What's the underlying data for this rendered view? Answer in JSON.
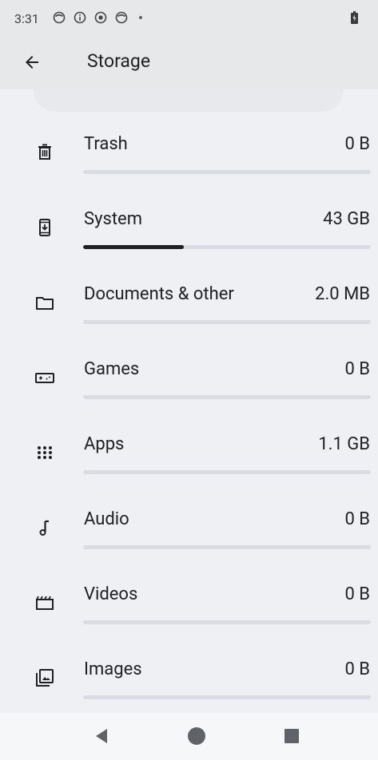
{
  "status_bar": {
    "time": "3:31",
    "icons": [
      "app-icon",
      "info-icon",
      "record-icon",
      "app-icon",
      "dot-icon"
    ],
    "battery_icon": "battery-charging-icon"
  },
  "app_bar": {
    "title": "Storage",
    "back_icon": "arrow-back-icon"
  },
  "storage_items": [
    {
      "label": "Trash",
      "value": "0 B",
      "icon": "trash-icon",
      "fill_fraction": 0
    },
    {
      "label": "System",
      "value": "43 GB",
      "icon": "system-update-icon",
      "fill_fraction": 0.35
    },
    {
      "label": "Documents & other",
      "value": "2.0 MB",
      "icon": "folder-icon",
      "fill_fraction": 0
    },
    {
      "label": "Games",
      "value": "0 B",
      "icon": "gamepad-icon",
      "fill_fraction": 0
    },
    {
      "label": "Apps",
      "value": "1.1 GB",
      "icon": "apps-grid-icon",
      "fill_fraction": 0
    },
    {
      "label": "Audio",
      "value": "0 B",
      "icon": "music-note-icon",
      "fill_fraction": 0
    },
    {
      "label": "Videos",
      "value": "0 B",
      "icon": "movie-icon",
      "fill_fraction": 0
    },
    {
      "label": "Images",
      "value": "0 B",
      "icon": "images-icon",
      "fill_fraction": 0
    }
  ],
  "nav_bar": {
    "back": "nav-back-icon",
    "home": "nav-home-icon",
    "recents": "nav-recents-icon"
  },
  "colors": {
    "background": "#eef0f3",
    "app_bar": "#e6e8ea",
    "bar_track": "#d9dde3",
    "bar_fill": "#202124"
  }
}
